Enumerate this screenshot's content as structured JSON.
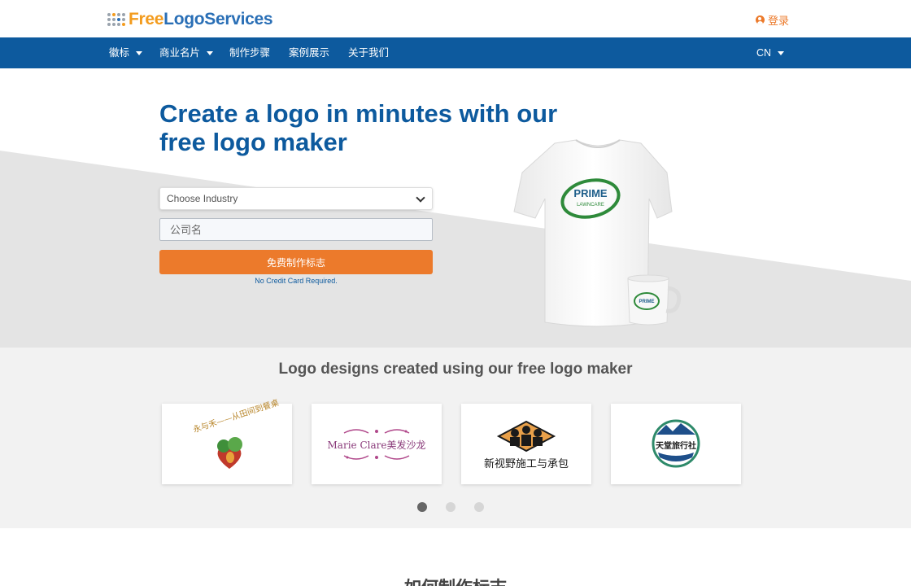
{
  "header": {
    "logo_text_free": "Free",
    "logo_text_main": "LogoServices",
    "login_label": "登录",
    "login_icon": "user-circle-icon"
  },
  "nav": {
    "items": [
      {
        "label": "徽标",
        "has_dropdown": true
      },
      {
        "label": "商业名片",
        "has_dropdown": true
      },
      {
        "label": "制作步骤",
        "has_dropdown": false
      },
      {
        "label": "案例展示",
        "has_dropdown": false
      },
      {
        "label": "关于我们",
        "has_dropdown": false
      }
    ],
    "language": "CN"
  },
  "hero": {
    "title": "Create a logo in minutes with our free logo maker",
    "industry_select": "Choose Industry",
    "company_placeholder": "公司名",
    "cta_label": "免费制作标志",
    "note": "No Credit Card Required.",
    "mockup_brand": "PRIME",
    "mockup_sub": "LAWNCARE"
  },
  "showcase": {
    "title": "Logo designs created using our free logo maker",
    "logos": [
      {
        "text": "永与禾——从田间到餐桌",
        "icon": "vegetable-heart-icon"
      },
      {
        "text": "Marie Clare美发沙龙",
        "icon": "ornament-frame-icon"
      },
      {
        "text": "新视野施工与承包",
        "icon": "workers-diamond-icon"
      },
      {
        "text": "天堂旅行社",
        "icon": "mountain-badge-icon"
      }
    ],
    "dots": 3,
    "active_dot": 0
  },
  "next_section_title": "如何制作标志",
  "colors": {
    "brand_blue": "#0d5a9e",
    "accent_orange": "#ec7a2b",
    "logo_yellow": "#f39c1f",
    "logo_blue": "#2a6fb6"
  }
}
